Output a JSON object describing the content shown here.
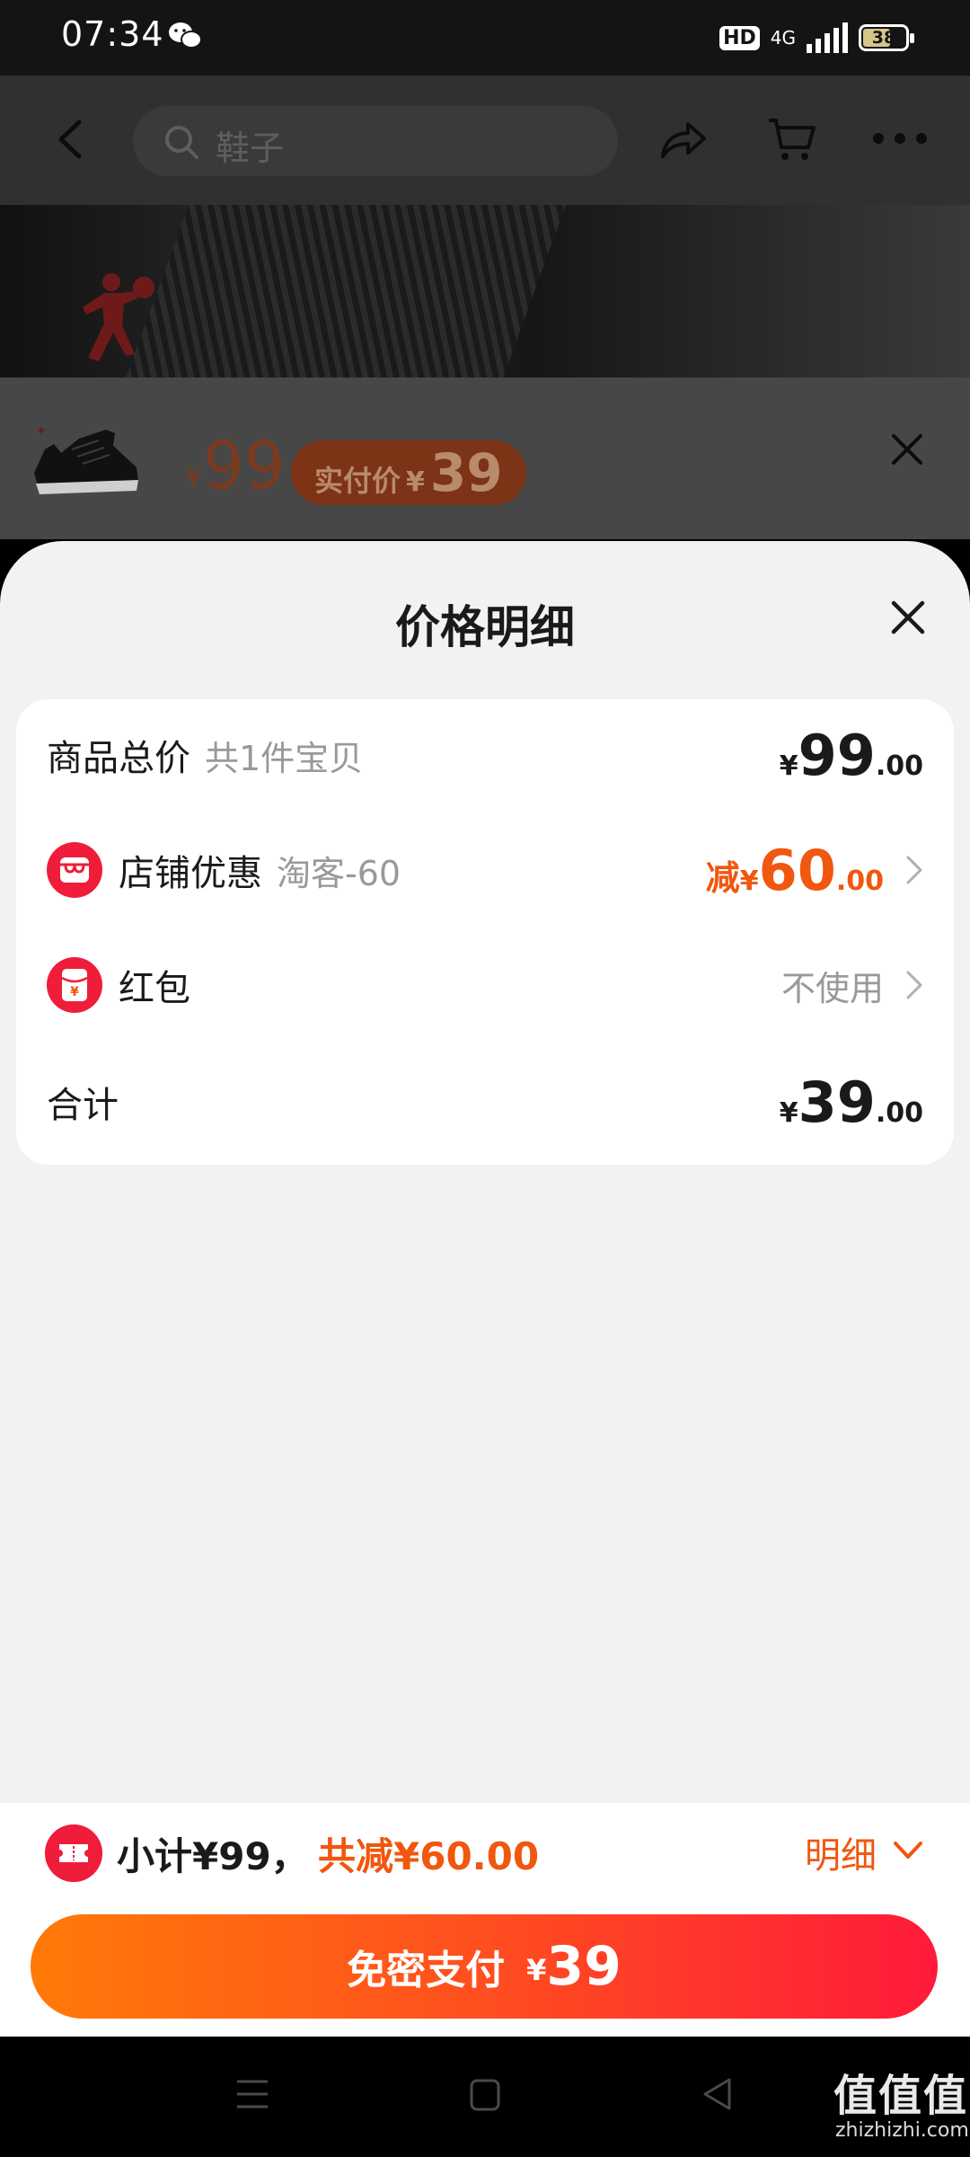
{
  "status_bar": {
    "time": "07:34",
    "hd": "HD",
    "network": "4G",
    "battery": "38"
  },
  "header": {
    "search_text": "鞋子",
    "icons": [
      "back-icon",
      "search-icon",
      "share-icon",
      "cart-icon",
      "more-icon"
    ]
  },
  "mini_card": {
    "currency": "¥",
    "price": "99",
    "actual_label": "实付价",
    "actual_currency": "¥",
    "actual_price": "39"
  },
  "sheet": {
    "title": "价格明细",
    "rows": {
      "total": {
        "label": "商品总价",
        "sub": "共1件宝贝",
        "currency": "¥",
        "int": "99",
        "dec": ".00"
      },
      "store": {
        "label": "店铺优惠",
        "sub": "淘客-60",
        "prefix": "减",
        "currency": "¥",
        "int": "60",
        "dec": ".00"
      },
      "redpacket": {
        "label": "红包",
        "value": "不使用"
      },
      "sum": {
        "label": "合计",
        "currency": "¥",
        "int": "39",
        "dec": ".00"
      }
    }
  },
  "bottom": {
    "subtotal": "小计¥99，",
    "discount": "共减¥60.00",
    "detail": "明细",
    "pay_label": "免密支付",
    "pay_currency": "¥",
    "pay_amount": "39"
  },
  "watermark": {
    "main": "值值值",
    "sub": "zhizhizhi.com"
  },
  "colors": {
    "accent_orange": "#f0570f",
    "accent_red": "#f01d3a",
    "sheet_bg": "#f2f2f2"
  }
}
